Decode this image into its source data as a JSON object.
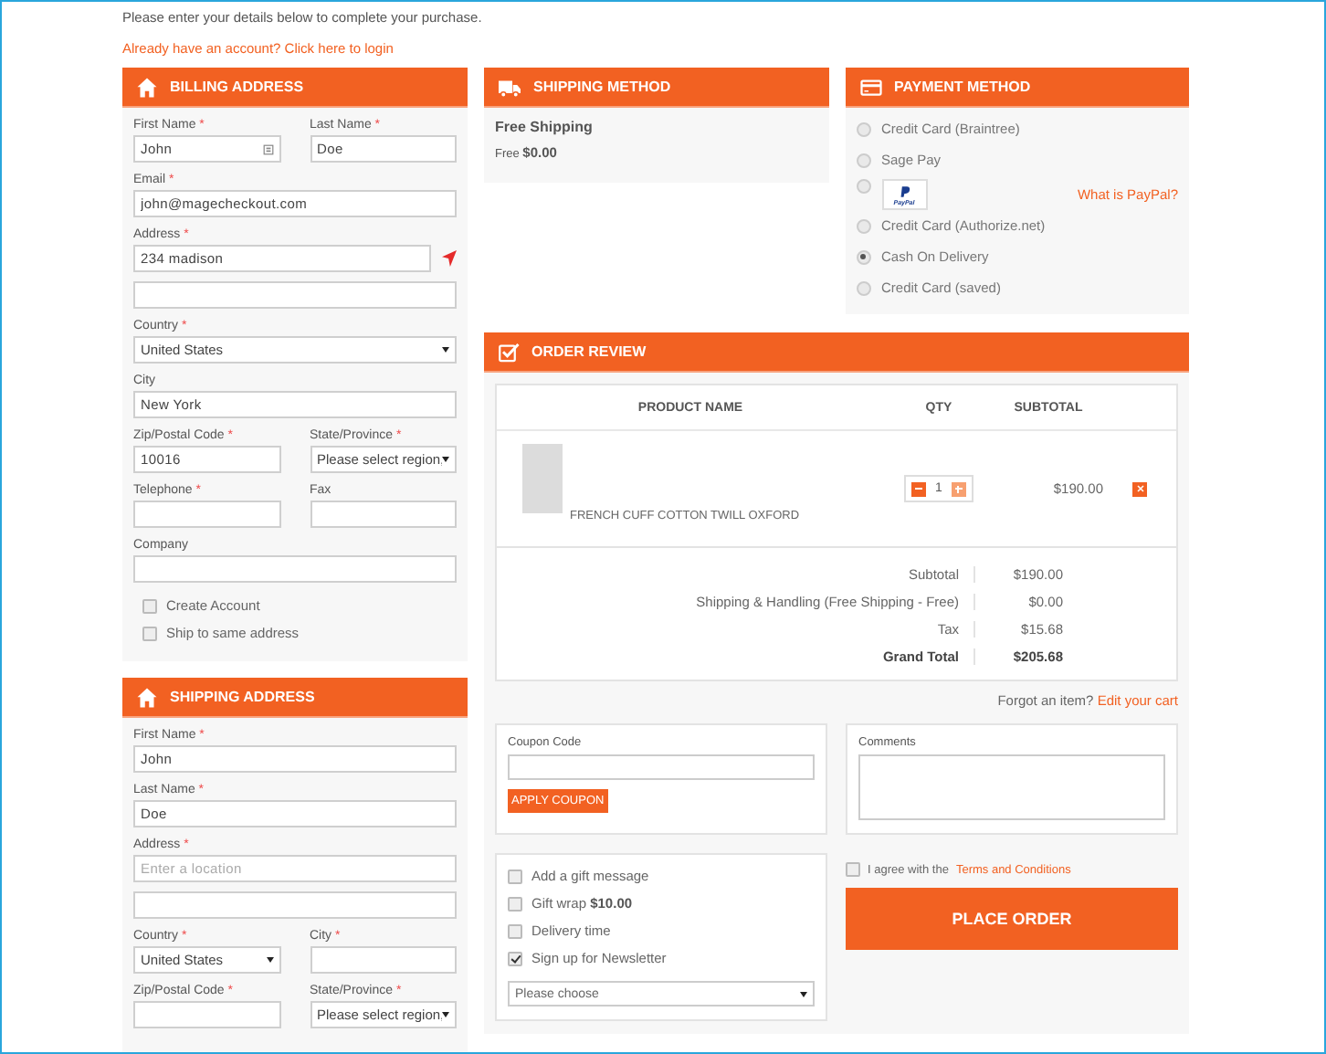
{
  "intro": "Please enter your details below to complete your purchase.",
  "login_link": "Already have an account? Click here to login",
  "required_mark": "*",
  "billing_address": {
    "title": "BILLING ADDRESS",
    "rows": [
      [
        {
          "kind": "text",
          "label": "First Name",
          "required": true,
          "value": "John",
          "contact_icon": true
        },
        {
          "kind": "text",
          "label": "Last Name",
          "required": true,
          "value": "Doe"
        }
      ],
      [
        {
          "kind": "text",
          "label": "Email",
          "required": true,
          "value": "john@magecheckout.com"
        }
      ],
      [
        {
          "kind": "text",
          "label": "Address",
          "required": true,
          "value": "234 madison",
          "locator_icon": true
        }
      ],
      [
        {
          "kind": "text"
        }
      ],
      [
        {
          "kind": "select",
          "label": "Country",
          "required": true,
          "value": "United States"
        }
      ],
      [
        {
          "kind": "text",
          "label": "City",
          "required": false,
          "value": "New York"
        }
      ],
      [
        {
          "kind": "text",
          "label": "Zip/Postal Code",
          "required": true,
          "value": "10016"
        },
        {
          "kind": "select",
          "label": "State/Province",
          "required": true,
          "value": "Please select region,"
        }
      ],
      [
        {
          "kind": "text",
          "label": "Telephone",
          "required": true
        },
        {
          "kind": "text",
          "label": "Fax",
          "required": false
        }
      ],
      [
        {
          "kind": "text",
          "label": "Company",
          "required": false
        }
      ]
    ],
    "options": [
      {
        "label": "Create Account",
        "checked": false
      },
      {
        "label": "Ship to same address",
        "checked": false
      }
    ]
  },
  "shipping_address": {
    "title": "SHIPPING ADDRESS",
    "rows": [
      [
        {
          "kind": "text",
          "label": "First Name",
          "required": true,
          "value": "John"
        }
      ],
      [
        {
          "kind": "text",
          "label": "Last Name",
          "required": true,
          "value": "Doe"
        }
      ],
      [
        {
          "kind": "text",
          "label": "Address",
          "required": true,
          "placeholder": "Enter a location"
        }
      ],
      [
        {
          "kind": "text"
        }
      ],
      [
        {
          "kind": "select",
          "label": "Country",
          "required": true,
          "value": "United States"
        },
        {
          "kind": "text",
          "label": "City",
          "required": true
        }
      ],
      [
        {
          "kind": "text",
          "label": "Zip/Postal Code",
          "required": true
        },
        {
          "kind": "select",
          "label": "State/Province",
          "required": true,
          "value": "Please select region,"
        }
      ]
    ]
  },
  "shipping_method": {
    "title": "SHIPPING METHOD",
    "method": "Free Shipping",
    "price_label": "Free",
    "price": "$0.00"
  },
  "payment_method": {
    "title": "PAYMENT METHOD",
    "options": [
      {
        "kind": "plain",
        "label": "Credit Card (Braintree)",
        "selected": false
      },
      {
        "kind": "plain",
        "label": "Sage Pay",
        "selected": false
      },
      {
        "kind": "paypal",
        "logo_text": "PayPal",
        "link": "What is PayPal?",
        "selected": false
      },
      {
        "kind": "plain",
        "label": "Credit Card (Authorize.net)",
        "selected": false
      },
      {
        "kind": "plain",
        "label": "Cash On Delivery",
        "selected": true
      },
      {
        "kind": "plain",
        "label": "Credit Card (saved)",
        "selected": false
      }
    ]
  },
  "order_review": {
    "title": "ORDER REVIEW",
    "columns": [
      "PRODUCT NAME",
      "QTY",
      "SUBTOTAL"
    ],
    "items": [
      {
        "name": "FRENCH CUFF COTTON TWILL OXFORD",
        "qty": "1",
        "subtotal": "$190.00"
      }
    ],
    "totals": [
      {
        "kind": "normal",
        "label": "Subtotal",
        "value": "$190.00"
      },
      {
        "kind": "normal",
        "label": "Shipping & Handling (Free Shipping - Free)",
        "value": "$0.00"
      },
      {
        "kind": "normal",
        "label": "Tax",
        "value": "$15.68"
      },
      {
        "kind": "grand",
        "label": "Grand Total",
        "value": "$205.68"
      }
    ],
    "forgot_text": "Forgot an item?",
    "edit_cart_link": "Edit your cart"
  },
  "coupon": {
    "label": "Coupon Code",
    "button": "APPLY COUPON"
  },
  "comments": {
    "label": "Comments"
  },
  "extras": {
    "options": [
      {
        "label": "Add a gift message",
        "checked": false
      },
      {
        "label": "Gift wrap **$10.00**",
        "checked": false
      },
      {
        "label": "Delivery time",
        "checked": false
      },
      {
        "label": "Sign up for Newsletter",
        "checked": true
      }
    ],
    "select": "Please choose"
  },
  "terms": {
    "checked": false,
    "text": "I agree with the",
    "link": "Terms and Conditions"
  },
  "place_order": "PLACE ORDER"
}
